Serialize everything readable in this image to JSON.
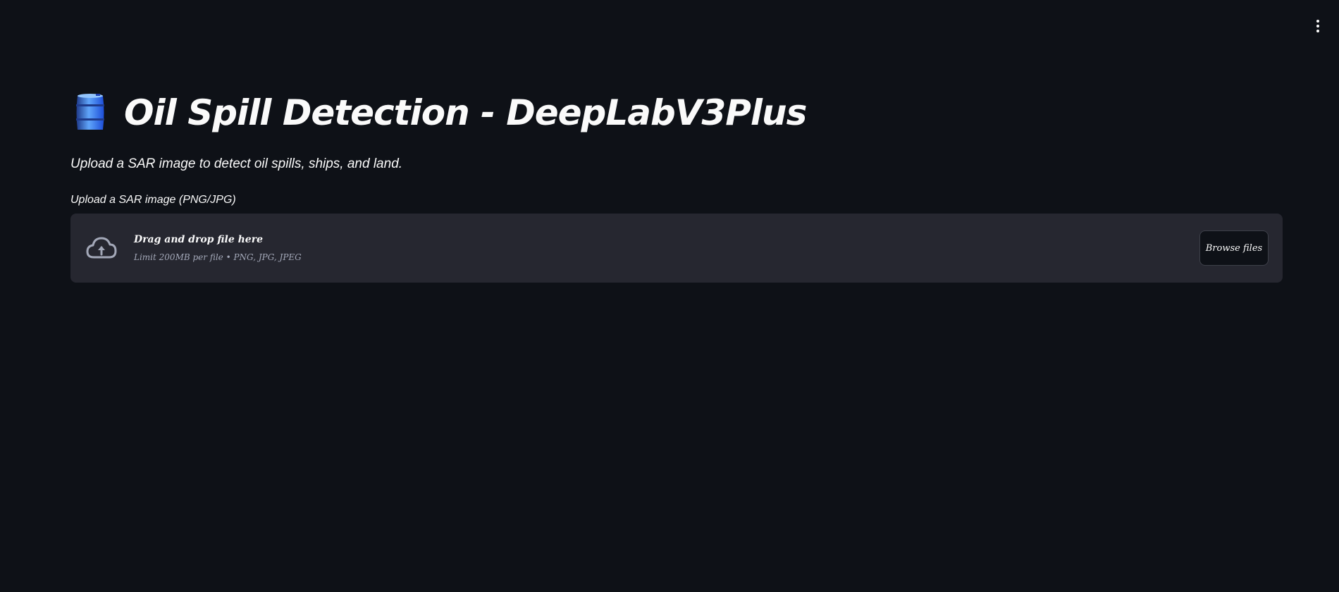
{
  "header": {
    "menu_icon": "kebab-menu-icon"
  },
  "main": {
    "title_icon": "oil-barrel-icon",
    "title": "Oil Spill Detection - DeepLabV3Plus",
    "subtitle": "Upload a SAR image to detect oil spills, ships, and land."
  },
  "uploader": {
    "label": "Upload a SAR image (PNG/JPG)",
    "icon": "cloud-upload-icon",
    "drop_text": "Drag and drop file here",
    "limit_text": "Limit 200MB per file • PNG, JPG, JPEG",
    "browse_label": "Browse files"
  },
  "colors": {
    "background": "#0e1117",
    "dropzone": "#262730",
    "text": "#fafafa",
    "muted_text": "#a3a8b8",
    "barrel_blue": "#3b82f6"
  }
}
